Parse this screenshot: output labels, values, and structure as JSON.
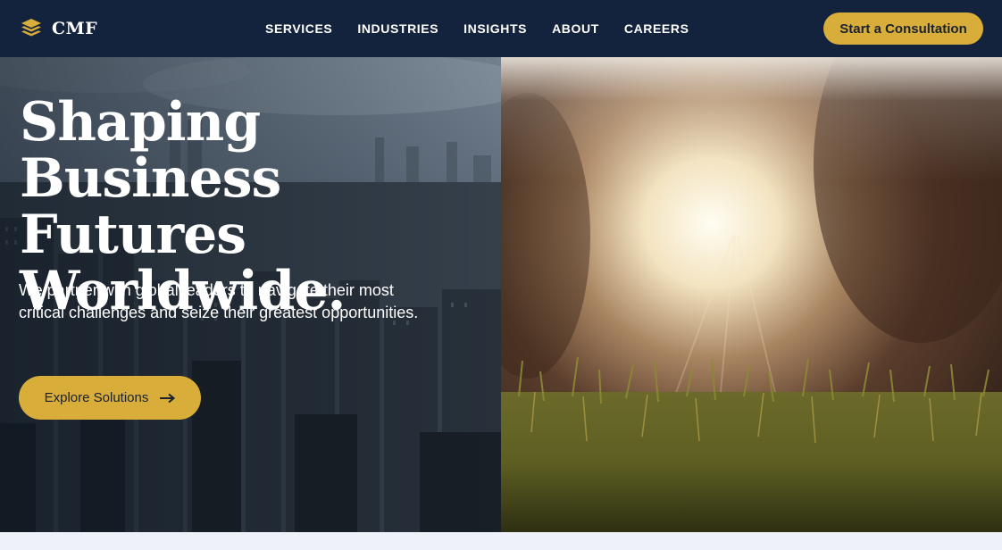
{
  "brand": {
    "name": "CMF",
    "logo_icon": "layers-icon",
    "logo_color": "#d9ad3a"
  },
  "nav": {
    "items": [
      {
        "label": "SERVICES"
      },
      {
        "label": "INDUSTRIES"
      },
      {
        "label": "INSIGHTS"
      },
      {
        "label": "ABOUT"
      },
      {
        "label": "CAREERS"
      }
    ],
    "cta_label": "Start a Consultation"
  },
  "hero": {
    "title_lines": [
      "Shaping",
      "Business Futures",
      "Worldwide."
    ],
    "subtitle": "We partner with global leaders to navigate their most critical challenges and seize their greatest opportunities.",
    "button_label": "Explore Solutions",
    "button_icon": "arrow-right-icon",
    "left_image": "city-skyline-photo",
    "right_image": "sunlit-grass-photo"
  },
  "colors": {
    "navbar_bg": "#14233d",
    "accent": "#d9ad3a",
    "page_bg": "#eef2f8"
  }
}
